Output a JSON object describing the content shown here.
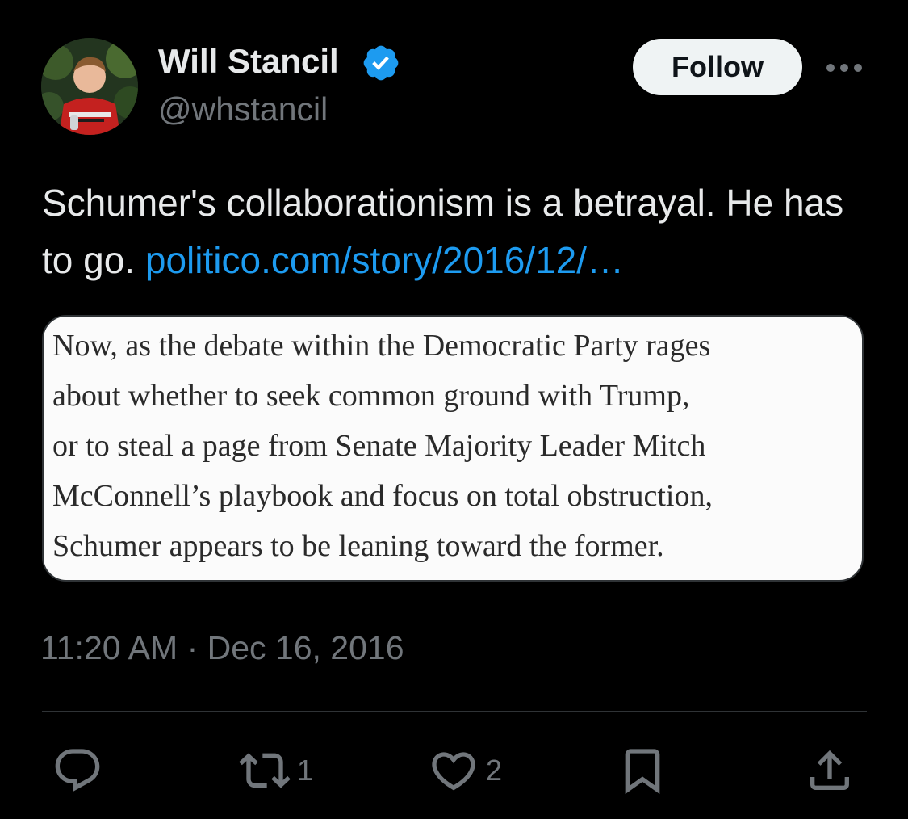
{
  "author": {
    "display_name": "Will Stancil",
    "handle": "@whstancil",
    "verified": true,
    "avatar_icon": "profile-photo"
  },
  "header": {
    "follow_label": "Follow",
    "more_icon": "more-options-icon"
  },
  "tweet": {
    "text": "Schumer's collaborationism is a betrayal. He has to go.",
    "link_text": "politico.com/story/2016/12/…",
    "timestamp": "11:20 AM · Dec 16, 2016"
  },
  "media": {
    "quote_lines": [
      "Now, as the debate within the Democratic Party rages",
      "about whether to seek common ground with Trump,",
      "or to steal a page from Senate Majority Leader Mitch",
      "McConnell’s playbook and focus on total obstruction,",
      "Schumer appears to be leaning toward the former."
    ]
  },
  "actions": {
    "reply": {
      "icon": "reply-icon",
      "count": ""
    },
    "retweet": {
      "icon": "retweet-icon",
      "count": "1"
    },
    "like": {
      "icon": "heart-icon",
      "count": "2"
    },
    "bookmark": {
      "icon": "bookmark-icon",
      "count": ""
    },
    "share": {
      "icon": "share-icon",
      "count": ""
    }
  },
  "colors": {
    "background": "#000000",
    "text_primary": "#e7e9ea",
    "text_secondary": "#71767b",
    "link": "#1d9bf0",
    "verified_badge": "#1d9bf0",
    "follow_button_bg": "#eff3f4",
    "divider": "#2f3336"
  }
}
